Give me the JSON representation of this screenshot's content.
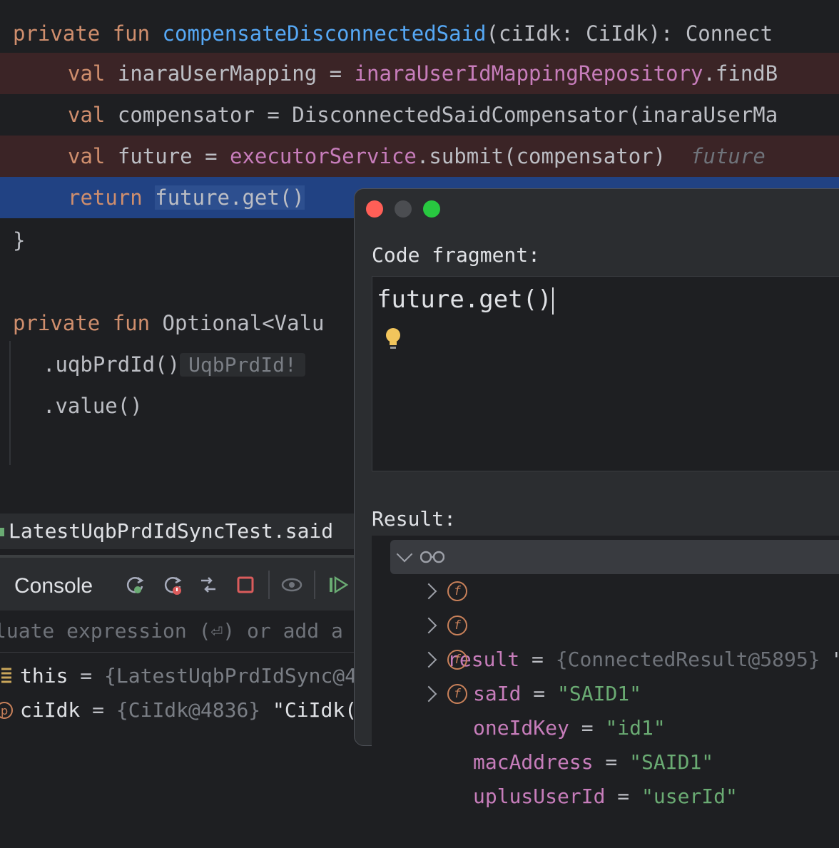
{
  "colors": {
    "background": "#1e1f22",
    "keyword": "#cf8e6d",
    "function": "#56a8f5",
    "property": "#c77dbb",
    "string": "#6aab73",
    "current_line": "#214283",
    "breakpoint_line": "#3b2426"
  },
  "editor": {
    "l1": {
      "kw1": "private",
      "kw2": "fun",
      "fn": "compensateDisconnectedSaid",
      "rest": "(ciIdk: CiIdk): Connect"
    },
    "l2": {
      "kw": "val",
      "a": "inaraUserMapping = ",
      "prop": "inaraUserIdMappingRepository",
      "b": ".findB"
    },
    "l3": {
      "kw": "val",
      "a": "compensator = DisconnectedSaidCompensator(inaraUserMa"
    },
    "l4": {
      "kw": "val",
      "a": "future = ",
      "prop": "executorService",
      "b": ".submit(compensator)",
      "hint": "future"
    },
    "l5": {
      "kw": "return",
      "sel": "future.get()"
    },
    "l6": {
      "text": "}"
    },
    "l7": {
      "kw1": "private",
      "kw2": "fun",
      "a": "Optional<Valu"
    },
    "l8": {
      "a": ".uqbPrdId()",
      "inlay": "UqbPrdId!"
    },
    "l9": {
      "a": ".value()"
    }
  },
  "debug": {
    "tab_label": "LatestUqbPrdIdSyncTest.said",
    "console_label": "Console",
    "eval_placeholder": "luate expression (⏎) or add a",
    "vars": [
      {
        "name": "this",
        "eq": " = ",
        "value": "{LatestUqbPrdIdSync@4"
      },
      {
        "name": "ciIdk",
        "eq": " = ",
        "value": "{CiIdk@4836}",
        "extra": " \"CiIdk("
      }
    ]
  },
  "dialog": {
    "code_label": "Code fragment:",
    "code_value": "future.get()",
    "result_label": "Result:",
    "result": {
      "name": "result",
      "eq": " = ",
      "value": "{ConnectedResult@5895}",
      "extra": " \""
    },
    "fields": [
      {
        "name": "saId",
        "eq": " = ",
        "value": "\"SAID1\""
      },
      {
        "name": "oneIdKey",
        "eq": " = ",
        "value": "\"id1\""
      },
      {
        "name": "macAddress",
        "eq": " = ",
        "value": "\"SAID1\""
      },
      {
        "name": "uplusUserId",
        "eq": " = ",
        "value": "\"userId\""
      }
    ],
    "field_badge": "f"
  }
}
